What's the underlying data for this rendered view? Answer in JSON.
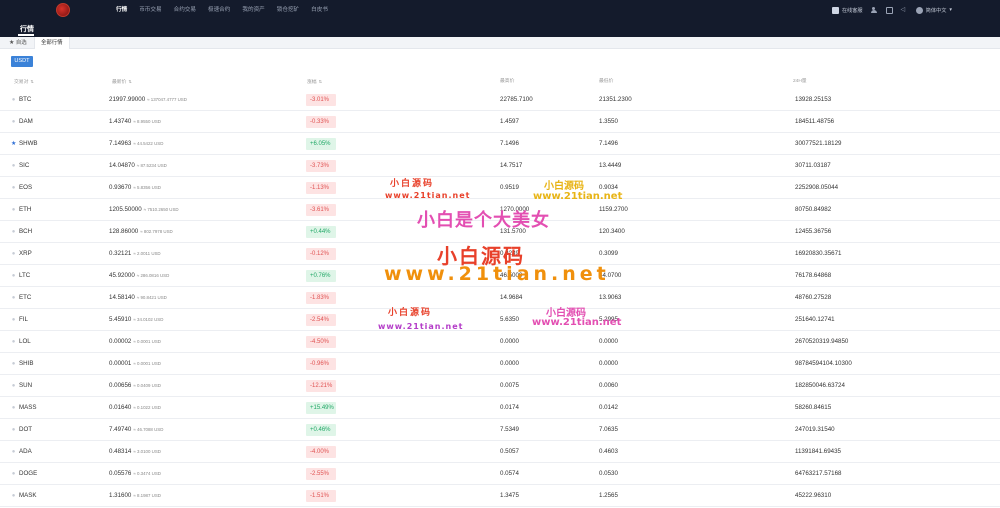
{
  "nav": {
    "logo_text": "",
    "items": [
      "行情",
      "币币交易",
      "合约交易",
      "极速合约",
      "我的资产",
      "锁仓挖矿",
      "白皮书"
    ],
    "active_index": 0,
    "download_label": "在线客服",
    "language_label": "简体中文"
  },
  "page": {
    "title": "行情"
  },
  "tabs": {
    "favorites": "自选",
    "all": "全部行情"
  },
  "quote_button": "USDT",
  "table": {
    "headers": {
      "pair": "交易对",
      "price": "最新价",
      "change": "涨幅",
      "high": "最高价",
      "low": "最低价",
      "volume": "24H量"
    },
    "rows": [
      {
        "symbol": "BTC",
        "fav": false,
        "price": "21997.99000",
        "conv": "≈ 137047.4777 USD",
        "change": "-3.01%",
        "dir": "neg",
        "high": "22785.7100",
        "low": "21351.2300",
        "volume": "13928.25153"
      },
      {
        "symbol": "DAM",
        "fav": false,
        "price": "1.43740",
        "conv": "≈ 8.9550 USD",
        "change": "-0.33%",
        "dir": "neg",
        "high": "1.4597",
        "low": "1.3550",
        "volume": "184511.48756"
      },
      {
        "symbol": "SHWB",
        "fav": true,
        "price": "7.14963",
        "conv": "≈ 44.5422 USD",
        "change": "+6.05%",
        "dir": "pos",
        "high": "7.1496",
        "low": "7.1496",
        "volume": "30077521.18129"
      },
      {
        "symbol": "SIC",
        "fav": false,
        "price": "14.04870",
        "conv": "≈ 87.5234 USD",
        "change": "-3.73%",
        "dir": "neg",
        "high": "14.7517",
        "low": "13.4449",
        "volume": "30711.03187"
      },
      {
        "symbol": "EOS",
        "fav": false,
        "price": "0.93670",
        "conv": "≈ 5.8356 USD",
        "change": "-1.13%",
        "dir": "neg",
        "high": "0.9519",
        "low": "0.9034",
        "volume": "2252908.05044"
      },
      {
        "symbol": "ETH",
        "fav": false,
        "price": "1205.50000",
        "conv": "≈ 7510.2650 USD",
        "change": "-3.61%",
        "dir": "neg",
        "high": "1270.0000",
        "low": "1159.2700",
        "volume": "80750.84982"
      },
      {
        "symbol": "BCH",
        "fav": false,
        "price": "128.86000",
        "conv": "≈ 802.7978 USD",
        "change": "+0.44%",
        "dir": "pos",
        "high": "131.5700",
        "low": "120.3400",
        "volume": "12455.36756"
      },
      {
        "symbol": "XRP",
        "fav": false,
        "price": "0.32121",
        "conv": "≈ 2.0011 USD",
        "change": "-0.12%",
        "dir": "neg",
        "high": "0.3239",
        "low": "0.3099",
        "volume": "16920830.35671"
      },
      {
        "symbol": "LTC",
        "fav": false,
        "price": "45.92000",
        "conv": "≈ 286.0816 USD",
        "change": "+0.76%",
        "dir": "pos",
        "high": "46.5000",
        "low": "44.0700",
        "volume": "76178.64868"
      },
      {
        "symbol": "ETC",
        "fav": false,
        "price": "14.58140",
        "conv": "≈ 90.8421 USD",
        "change": "-1.83%",
        "dir": "neg",
        "high": "14.9684",
        "low": "13.9063",
        "volume": "48760.27528"
      },
      {
        "symbol": "FIL",
        "fav": false,
        "price": "5.45910",
        "conv": "≈ 34.0102 USD",
        "change": "-2.54%",
        "dir": "neg",
        "high": "5.6350",
        "low": "5.2995",
        "volume": "251640.12741"
      },
      {
        "symbol": "LOL",
        "fav": false,
        "price": "0.00002",
        "conv": "≈ 0.0001 USD",
        "change": "-4.50%",
        "dir": "neg",
        "high": "0.0000",
        "low": "0.0000",
        "volume": "2670520319.94850"
      },
      {
        "symbol": "SHIB",
        "fav": false,
        "price": "0.00001",
        "conv": "≈ 0.0001 USD",
        "change": "-0.96%",
        "dir": "neg",
        "high": "0.0000",
        "low": "0.0000",
        "volume": "98784594104.10300"
      },
      {
        "symbol": "SUN",
        "fav": false,
        "price": "0.00656",
        "conv": "≈ 0.0409 USD",
        "change": "-12.21%",
        "dir": "neg",
        "high": "0.0075",
        "low": "0.0060",
        "volume": "182850046.63724"
      },
      {
        "symbol": "MASS",
        "fav": false,
        "price": "0.01640",
        "conv": "≈ 0.1022 USD",
        "change": "+15.49%",
        "dir": "pos",
        "high": "0.0174",
        "low": "0.0142",
        "volume": "58260.84615"
      },
      {
        "symbol": "DOT",
        "fav": false,
        "price": "7.49740",
        "conv": "≈ 46.7088 USD",
        "change": "+0.46%",
        "dir": "pos",
        "high": "7.5349",
        "low": "7.0635",
        "volume": "247019.31540"
      },
      {
        "symbol": "ADA",
        "fav": false,
        "price": "0.48314",
        "conv": "≈ 3.0100 USD",
        "change": "-4.00%",
        "dir": "neg",
        "high": "0.5057",
        "low": "0.4603",
        "volume": "11391841.69435"
      },
      {
        "symbol": "DOGE",
        "fav": false,
        "price": "0.05576",
        "conv": "≈ 0.3474 USD",
        "change": "-2.55%",
        "dir": "neg",
        "high": "0.0574",
        "low": "0.0530",
        "volume": "64763217.57168"
      },
      {
        "symbol": "MASK",
        "fav": false,
        "price": "1.31600",
        "conv": "≈ 8.1987 USD",
        "change": "-1.51%",
        "dir": "neg",
        "high": "1.3475",
        "low": "1.2565",
        "volume": "45222.96310"
      }
    ]
  },
  "colors": {
    "nav_bg": "#141b2c",
    "accent": "#3b82d8",
    "negative": "#e05252",
    "positive": "#22a867"
  },
  "watermark": {
    "line1": "小白源码",
    "line2": "www.21tian.net",
    "line3": "小白源码",
    "line4": "www.21tian.net",
    "line5": "小白是个大美女",
    "line6": "小白源码",
    "line7": "www.21tian.net",
    "line8": "小白源码",
    "line9": "www.21tian.net",
    "line10": "小白源码",
    "line11": "www.21tian.net"
  }
}
